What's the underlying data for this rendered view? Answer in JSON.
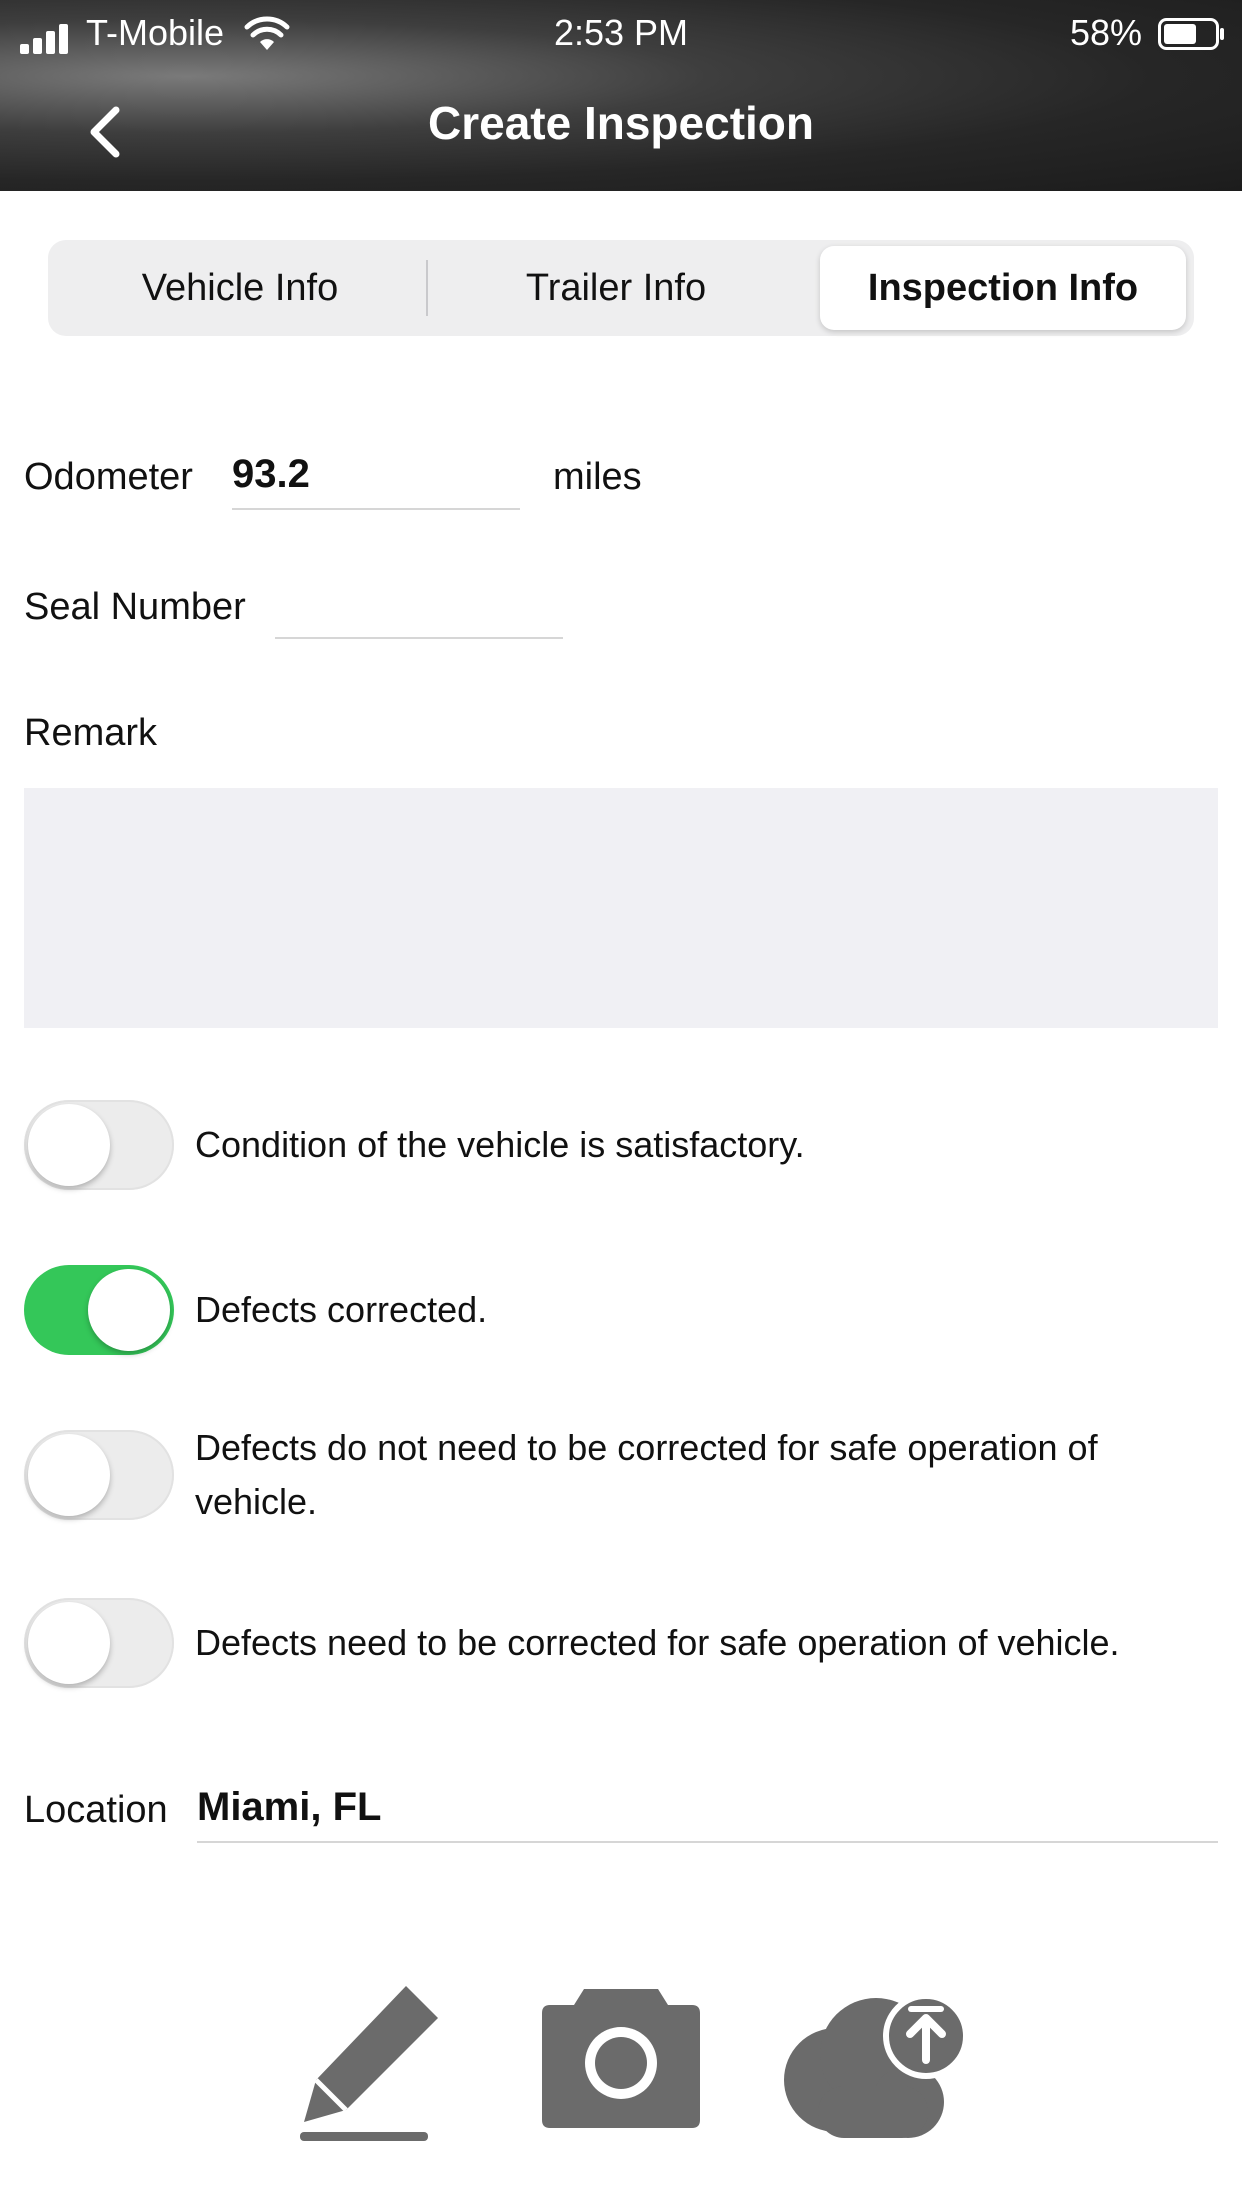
{
  "status_bar": {
    "carrier": "T-Mobile",
    "time": "2:53 PM",
    "battery_percent": "58%"
  },
  "header": {
    "title": "Create Inspection",
    "back_icon": "chevron-left-icon"
  },
  "tabs": [
    {
      "label": "Vehicle Info",
      "active": false
    },
    {
      "label": "Trailer Info",
      "active": false
    },
    {
      "label": "Inspection Info",
      "active": true
    }
  ],
  "form": {
    "odometer": {
      "label": "Odometer",
      "value": "93.2",
      "unit": "miles"
    },
    "seal_number": {
      "label": "Seal Number",
      "value": ""
    },
    "remark": {
      "label": "Remark",
      "value": ""
    },
    "toggles": [
      {
        "label": "Condition of the vehicle is satisfactory.",
        "on": false
      },
      {
        "label": "Defects corrected.",
        "on": true
      },
      {
        "label": "Defects do not need to be corrected for safe operation of vehicle.",
        "on": false
      },
      {
        "label": "Defects need to be corrected for safe operation of vehicle.",
        "on": false
      }
    ],
    "location": {
      "label": "Location",
      "value": "Miami, FL"
    }
  },
  "bottom_actions": [
    {
      "icon": "pencil-icon"
    },
    {
      "icon": "camera-icon"
    },
    {
      "icon": "cloud-upload-icon"
    }
  ],
  "colors": {
    "toggle_on": "#34c759",
    "toggle_off": "#ececec",
    "icon_gray": "#6b6b6b"
  }
}
